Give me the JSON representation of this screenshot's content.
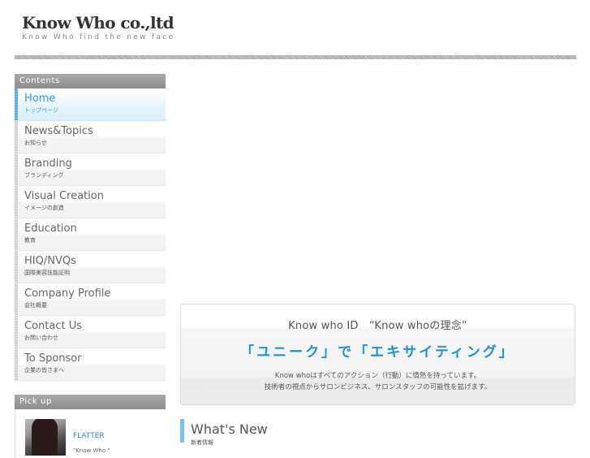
{
  "header": {
    "logo_title": "Know Who co.,ltd",
    "logo_tagline": "Know Who find the new face"
  },
  "sidebar": {
    "heading": "Contents",
    "items": [
      {
        "label": "Home",
        "sub": "トップページ",
        "active": true
      },
      {
        "label": "News&Topics",
        "sub": "お知らせ"
      },
      {
        "label": "Branding",
        "sub": "ブランディング"
      },
      {
        "label": "Visual Creation",
        "sub": "イメージの創造"
      },
      {
        "label": "Education",
        "sub": "教育"
      },
      {
        "label": "HIQ/NVQs",
        "sub": "国際美容技能証明"
      },
      {
        "label": "Company Profile",
        "sub": "会社概要"
      },
      {
        "label": "Contact Us",
        "sub": "お問い合わせ"
      },
      {
        "label": "To Sponsor",
        "sub": "企業の皆さまへ"
      }
    ]
  },
  "pickup": {
    "heading": "Pick up",
    "item_title": "FLATTER",
    "item_desc": "\"Know Who          \""
  },
  "banner": {
    "line1": "Know who ID　“Know whoの理念”",
    "catch": "「ユニーク」で「エキサイティング」",
    "desc1": "Know whoはすべてのアクション（行動）に情熱を持っています。",
    "desc2": "技術者の視点からサロンビジネス、サロンスタッフの可能性を拡げます。"
  },
  "whats_new": {
    "title": "What's New",
    "sub": "新着情報"
  },
  "colors": {
    "accent": "#2b9be3",
    "sidebar_header": "#9a9a9a"
  }
}
